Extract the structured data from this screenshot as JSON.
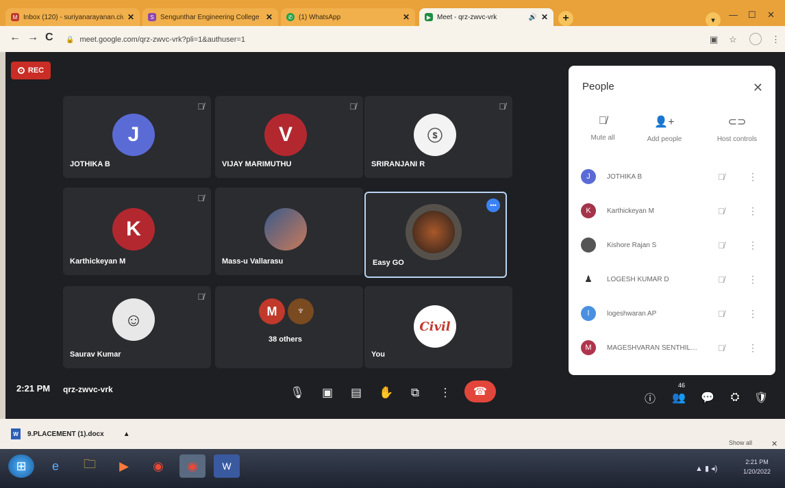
{
  "browser": {
    "tabs": [
      {
        "label": "Inbox (120) - suriyanarayanan.civil@gm…",
        "active": false
      },
      {
        "label": "Sengunthar Engineering College",
        "active": false
      },
      {
        "label": "(1) WhatsApp",
        "active": false
      },
      {
        "label": "Meet - qrz-zwvc-vrk",
        "active": true
      }
    ],
    "new_tab": "+",
    "url": "meet.google.com/qrz-zwvc-vrk?pli=1&authuser=1"
  },
  "meet": {
    "rec_label": "REC",
    "tiles": [
      {
        "name": "JOTHIKA B",
        "initial": "J",
        "color": "#5b6bd6",
        "muted": true
      },
      {
        "name": "VIJAY MARIMUTHU",
        "initial": "V",
        "color": "#b3282f",
        "muted": true
      },
      {
        "name": "SRIRANJANI R",
        "initial": "",
        "color": "#f3f3f3",
        "muted": true
      },
      {
        "name": "Karthickeyan M",
        "initial": "K",
        "color": "#b3282f",
        "muted": true
      },
      {
        "name": "Mass-u Vallarasu",
        "initial": "",
        "color": "#7a8aa0",
        "muted": false
      },
      {
        "name": "Easy GO",
        "initial": "",
        "color": "#4a3a30",
        "muted": false
      },
      {
        "name": "Saurav Kumar",
        "initial": "",
        "color": "#ddd",
        "muted": true
      },
      {
        "name": "38 others",
        "initial": "M",
        "color": "#c0392b",
        "muted": false
      },
      {
        "name": "You",
        "initial": "Civil",
        "color": "#ffffff",
        "muted": false
      }
    ],
    "time": "2:21 PM",
    "meeting_code": "qrz-zwvc-vrk",
    "people_count": "46"
  },
  "people_panel": {
    "title": "People",
    "actions": [
      {
        "label": "Mute all",
        "icon": "mic-off-icon"
      },
      {
        "label": "Add people",
        "icon": "add-person-icon"
      },
      {
        "label": "Host controls",
        "icon": "toggle-icon"
      }
    ],
    "participants": [
      {
        "name": "JOTHIKA B",
        "initial": "J",
        "color": "#5b6bd6"
      },
      {
        "name": "Karthickeyan M",
        "initial": "K",
        "color": "#a3344a"
      },
      {
        "name": "Kishore Rajan S",
        "initial": "",
        "color": "#555"
      },
      {
        "name": "LOGESH KUMAR D",
        "initial": "",
        "color": "#ffffff"
      },
      {
        "name": "logeshwaran AP",
        "initial": "l",
        "color": "#4a90e2"
      },
      {
        "name": "MAGESHVARAN SENTHIL…",
        "initial": "M",
        "color": "#b0344e"
      }
    ]
  },
  "download_bar": {
    "file": "9.PLACEMENT (1).docx",
    "show_all": "Show all"
  },
  "taskbar": {
    "clock_time": "2:21 PM",
    "clock_date": "1/20/2022"
  }
}
